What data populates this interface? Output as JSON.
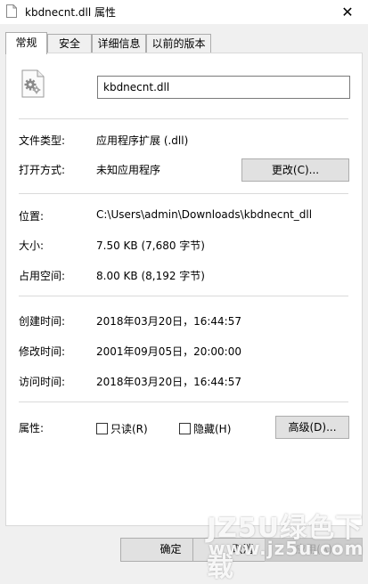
{
  "window": {
    "title": "kbdnecnt.dll 属性",
    "close_glyph": "✕"
  },
  "tabs": [
    {
      "label": "常规",
      "active": true
    },
    {
      "label": "安全",
      "active": false
    },
    {
      "label": "详细信息",
      "active": false
    },
    {
      "label": "以前的版本",
      "active": false
    }
  ],
  "general": {
    "icon": "dll-file-icon",
    "file_name": "kbdnecnt.dll",
    "file_type_label": "文件类型:",
    "file_type_value": "应用程序扩展 (.dll)",
    "opens_with_label": "打开方式:",
    "opens_with_value": "未知应用程序",
    "change_button": "更改(C)...",
    "location_label": "位置:",
    "location_value": "C:\\Users\\admin\\Downloads\\kbdnecnt_dll",
    "size_label": "大小:",
    "size_value": "7.50 KB (7,680 字节)",
    "size_on_disk_label": "占用空间:",
    "size_on_disk_value": "8.00 KB (8,192 字节)",
    "created_label": "创建时间:",
    "created_value": "2018年03月20日，16:44:57",
    "modified_label": "修改时间:",
    "modified_value": "2001年09月05日，20:00:00",
    "accessed_label": "访问时间:",
    "accessed_value": "2018年03月20日，16:44:57",
    "attributes_label": "属性:",
    "readonly_label": "只读(R)",
    "readonly_checked": false,
    "hidden_label": "隐藏(H)",
    "hidden_checked": false,
    "advanced_button": "高级(D)..."
  },
  "footer": {
    "ok": "确定",
    "cancel": "取消",
    "apply": "应用(A)",
    "apply_enabled": false
  },
  "watermark": {
    "main": "JZ5U绿色下载",
    "sub": "www.jz5u.com"
  }
}
